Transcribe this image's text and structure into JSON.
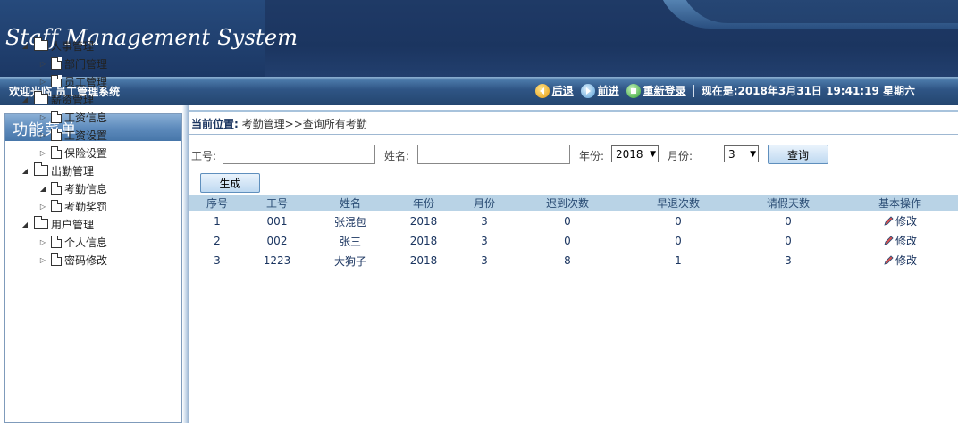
{
  "header": {
    "title": "Staff Management System"
  },
  "navbar": {
    "welcome": "欢迎光临 员工管理系统",
    "back": "后退",
    "forward": "前进",
    "relogin": "重新登录",
    "now": "现在是:2018年3月31日 19:41:19 星期六"
  },
  "sidebar": {
    "title": "功能菜单",
    "groups": [
      {
        "label": "人事管理",
        "items": [
          "部门管理",
          "员工管理"
        ]
      },
      {
        "label": "薪资管理",
        "items": [
          "工资信息",
          "工资设置",
          "保险设置"
        ]
      },
      {
        "label": "出勤管理",
        "items": [
          "考勤信息",
          "考勤奖罚"
        ]
      },
      {
        "label": "用户管理",
        "items": [
          "个人信息",
          "密码修改"
        ]
      }
    ]
  },
  "breadcrumb": {
    "prefix": "当前位置:",
    "path": "考勤管理>>查询所有考勤"
  },
  "filter": {
    "emp_no_label": "工号:",
    "emp_no_value": "",
    "name_label": "姓名:",
    "name_value": "",
    "year_label": "年份:",
    "year_value": "2018",
    "month_label": "月份:",
    "month_value": "3",
    "query_button": "查询",
    "generate_button": "生成"
  },
  "table": {
    "columns": [
      "序号",
      "工号",
      "姓名",
      "年份",
      "月份",
      "迟到次数",
      "早退次数",
      "请假天数",
      "基本操作"
    ],
    "rows": [
      [
        "1",
        "001",
        "张混包",
        "2018",
        "3",
        "0",
        "0",
        "0",
        "修改"
      ],
      [
        "2",
        "002",
        "张三",
        "2018",
        "3",
        "0",
        "0",
        "0",
        "修改"
      ],
      [
        "3",
        "1223",
        "大狗子",
        "2018",
        "3",
        "8",
        "1",
        "3",
        "修改"
      ]
    ]
  },
  "colors": {
    "header_bg": "#1f3a66",
    "table_header_bg": "#b9d3e6",
    "link_text": "#1b3560"
  }
}
